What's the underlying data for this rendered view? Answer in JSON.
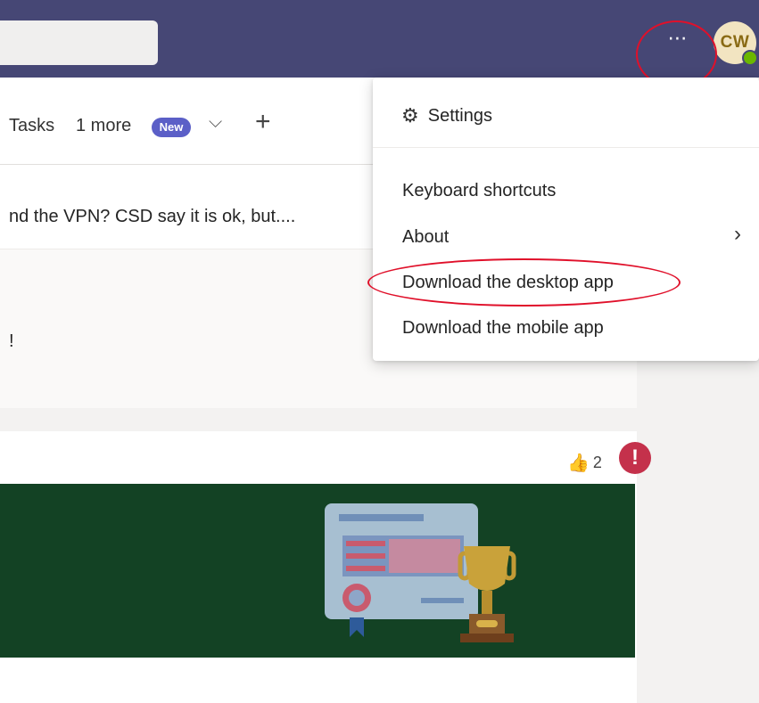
{
  "topbar": {
    "more_label": "⋯",
    "avatar_initials": "CW"
  },
  "tabs": {
    "tasks": "Tasks",
    "more": "1 more",
    "new_badge": "New"
  },
  "posts": {
    "post1_text": "nd the VPN? CSD say it is ok, but....",
    "post2_text": "!",
    "reaction_count": "2"
  },
  "menu": {
    "settings": "Settings",
    "keyboard_shortcuts": "Keyboard shortcuts",
    "about": "About",
    "download_desktop": "Download the desktop app",
    "download_mobile": "Download the mobile app"
  },
  "colors": {
    "topbar": "#464775",
    "banner": "#134224",
    "highlight": "#e0102a",
    "badge": "#5b5fc7"
  }
}
